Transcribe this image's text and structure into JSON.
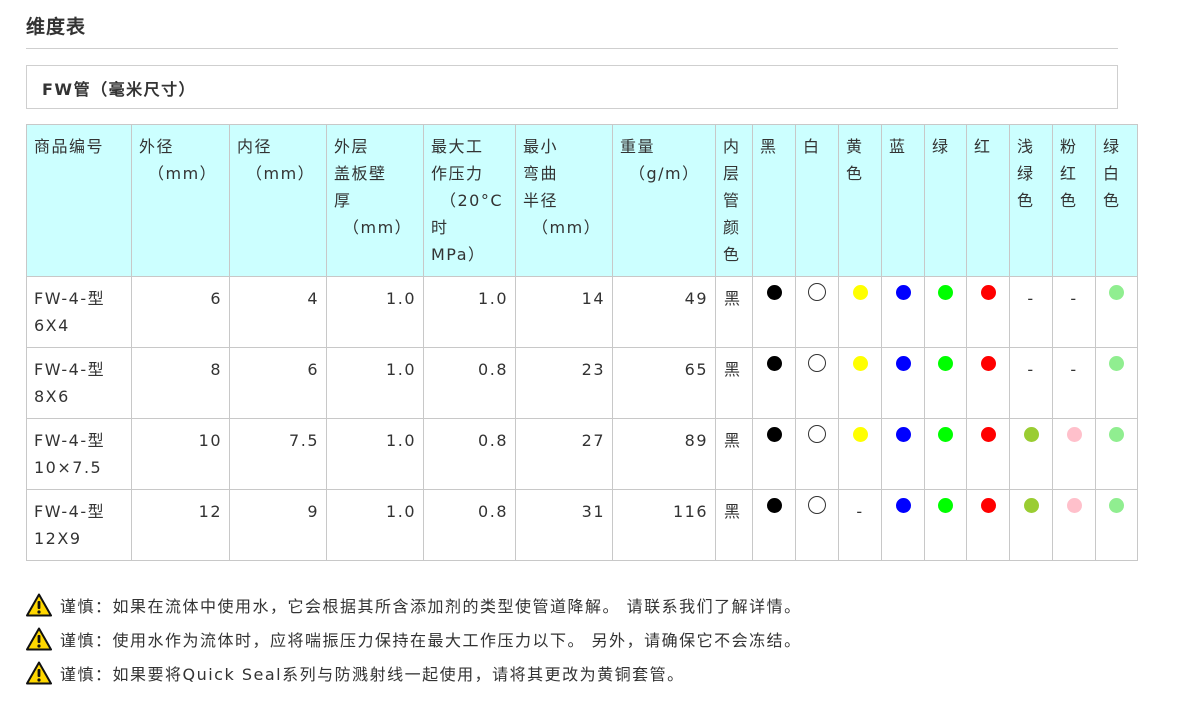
{
  "page": {
    "section_title": "维度表",
    "subtitle": "FW管（毫米尺寸）"
  },
  "table": {
    "headers": [
      [
        "商品编号"
      ],
      [
        "外径",
        "（mm）"
      ],
      [
        "内径",
        "（mm）"
      ],
      [
        "外层",
        "盖板壁",
        "厚",
        "（mm）"
      ],
      [
        "最大工",
        "作压力",
        "（20°C",
        "时",
        "MPa）"
      ],
      [
        "最小",
        "弯曲",
        "半径",
        "（mm）"
      ],
      [
        "重量",
        "（g/m）"
      ],
      [
        "内",
        "层",
        "管",
        "颜",
        "色"
      ],
      [
        "黑"
      ],
      [
        "白"
      ],
      [
        "黄",
        "色"
      ],
      [
        "蓝"
      ],
      [
        "绿"
      ],
      [
        "红"
      ],
      [
        "浅",
        "绿",
        "色"
      ],
      [
        "粉",
        "红",
        "色"
      ],
      [
        "绿",
        "白",
        "色"
      ]
    ],
    "rows": [
      {
        "model": [
          "FW-4-型",
          "6X4"
        ],
        "od": "6",
        "id": "4",
        "wall": "1.0",
        "pressure": "1.0",
        "bend": "14",
        "weight": "49",
        "inner_color": "黑",
        "colors": [
          "black",
          "white",
          "yellow",
          "blue",
          "green",
          "red",
          "-",
          "-",
          "lightgreen"
        ]
      },
      {
        "model": [
          "FW-4-型",
          "8X6"
        ],
        "od": "8",
        "id": "6",
        "wall": "1.0",
        "pressure": "0.8",
        "bend": "23",
        "weight": "65",
        "inner_color": "黑",
        "colors": [
          "black",
          "white",
          "yellow",
          "blue",
          "green",
          "red",
          "-",
          "-",
          "lightgreen"
        ]
      },
      {
        "model": [
          "FW-4-型",
          "10×7.5"
        ],
        "od": "10",
        "id": "7.5",
        "wall": "1.0",
        "pressure": "0.8",
        "bend": "27",
        "weight": "89",
        "inner_color": "黑",
        "colors": [
          "black",
          "white",
          "yellow",
          "blue",
          "green",
          "red",
          "olive",
          "pink",
          "lightgreen"
        ]
      },
      {
        "model": [
          "FW-4-型",
          "12X9"
        ],
        "od": "12",
        "id": "9",
        "wall": "1.0",
        "pressure": "0.8",
        "bend": "31",
        "weight": "116",
        "inner_color": "黑",
        "colors": [
          "black",
          "white",
          "-",
          "blue",
          "green",
          "red",
          "olive",
          "pink",
          "lightgreen"
        ]
      }
    ]
  },
  "swatches": {
    "black": "#000000",
    "white": "#ffffff",
    "yellow": "#ffff00",
    "blue": "#0000ff",
    "green": "#00ff00",
    "red": "#ff0000",
    "olive": "#9acd32",
    "pink": "#ffc0cb",
    "lightgreen": "#90ee90"
  },
  "notes": [
    {
      "icon": "warning-icon",
      "text": "谨慎：如果在流体中使用水，它会根据其所含添加剂的类型使管道降解。 请联系我们了解详情。"
    },
    {
      "icon": "warning-icon",
      "text": "谨慎：使用水作为流体时，应将喘振压力保持在最大工作压力以下。 另外，请确保它不会冻结。"
    },
    {
      "icon": "warning-icon",
      "text": "谨慎：如果要将Quick Seal系列与防溅射线一起使用，请将其更改为黄铜套管。"
    }
  ],
  "colors": {
    "header_bg": "#ccffff",
    "border": "#c8c8c8",
    "warning_yellow": "#ffd700"
  }
}
